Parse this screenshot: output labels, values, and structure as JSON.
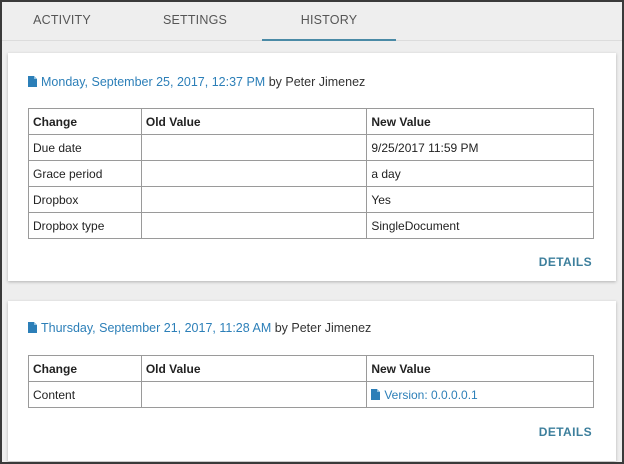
{
  "tabs": [
    {
      "label": "ACTIVITY"
    },
    {
      "label": "SETTINGS"
    },
    {
      "label": "HISTORY",
      "active": true
    }
  ],
  "entries": [
    {
      "date_link": "Monday, September 25, 2017, 12:37 PM",
      "by_text": "by Peter Jimenez",
      "columns": [
        "Change",
        "Old Value",
        "New Value"
      ],
      "rows": [
        {
          "change": "Due date",
          "old": "",
          "new": "9/25/2017 11:59 PM"
        },
        {
          "change": "Grace period",
          "old": "",
          "new": "a day"
        },
        {
          "change": "Dropbox",
          "old": "",
          "new": "Yes"
        },
        {
          "change": "Dropbox type",
          "old": "",
          "new": "SingleDocument"
        }
      ],
      "details_label": "DETAILS"
    },
    {
      "date_link": "Thursday, September 21, 2017, 11:28 AM",
      "by_text": "by Peter Jimenez",
      "columns": [
        "Change",
        "Old Value",
        "New Value"
      ],
      "rows": [
        {
          "change": "Content",
          "old": "",
          "new": "Version: 0.0.0.0.1",
          "new_is_link": true
        }
      ],
      "details_label": "DETAILS"
    }
  ],
  "colors": {
    "link": "#2c7fb8",
    "accent": "#4a8aa6",
    "details": "#3d7f9c"
  },
  "icons": {
    "entry": "document-icon",
    "version": "document-icon"
  }
}
